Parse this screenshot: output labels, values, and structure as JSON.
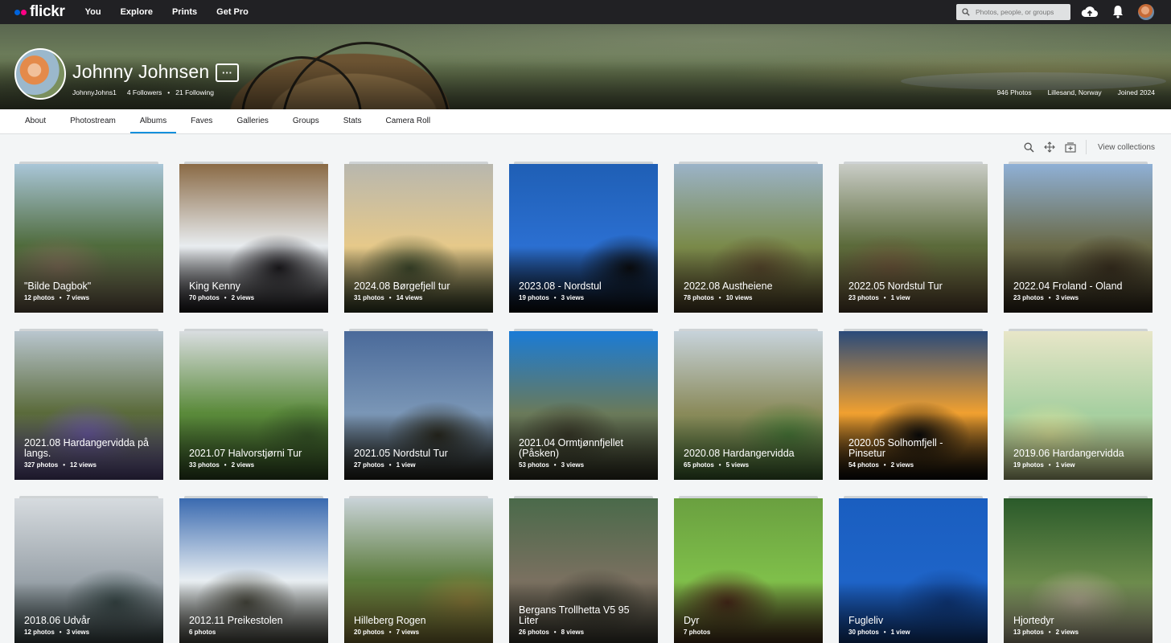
{
  "nav": {
    "logo": "flickr",
    "links": [
      "You",
      "Explore",
      "Prints",
      "Get Pro"
    ],
    "search_placeholder": "Photos, people, or groups",
    "icons": [
      "upload-icon",
      "bell-icon"
    ]
  },
  "profile": {
    "name": "Johnny Johnsen",
    "more_label": "···",
    "username": "JohnnyJohns1",
    "followers": "4 Followers",
    "separator": "•",
    "following": "21 Following",
    "photos": "946 Photos",
    "location": "Lillesand, Norway",
    "joined": "Joined 2024"
  },
  "tabs": [
    "About",
    "Photostream",
    "Albums",
    "Faves",
    "Galleries",
    "Groups",
    "Stats",
    "Camera Roll"
  ],
  "active_tab": "Albums",
  "toolbar": {
    "view_collections": "View collections"
  },
  "albums": [
    {
      "title": "\"Bilde Dagbok\"",
      "photos": "12 photos",
      "views": "7 views",
      "colors": [
        "#a9c6d8",
        "#4f6b3c",
        "#7a6a55"
      ]
    },
    {
      "title": "King Kenny",
      "photos": "70 photos",
      "views": "2 views",
      "colors": [
        "#8a6a45",
        "#e8ecef",
        "#1d1b1f"
      ]
    },
    {
      "title": "2024.08 Børgefjell tur",
      "photos": "31 photos",
      "views": "14 views",
      "colors": [
        "#b8b7ae",
        "#e6c98a",
        "#3f4a2d"
      ]
    },
    {
      "title": "2023.08 - Nordstul",
      "photos": "19 photos",
      "views": "3 views",
      "colors": [
        "#1f5fb5",
        "#2b6fd1",
        "#0b0d10"
      ]
    },
    {
      "title": "2022.08 Austheiene",
      "photos": "78 photos",
      "views": "10 views",
      "colors": [
        "#9bb3c8",
        "#7a8a4a",
        "#5a4a2e"
      ]
    },
    {
      "title": "2022.05 Nordstul Tur",
      "photos": "23 photos",
      "views": "1 view",
      "colors": [
        "#c9ccc6",
        "#5b6a3a",
        "#6a553a"
      ]
    },
    {
      "title": "2022.04 Froland - Oland",
      "photos": "23 photos",
      "views": "3 views",
      "colors": [
        "#8fb0d6",
        "#6a6a48",
        "#3a3020"
      ]
    },
    {
      "title": "2021.08 Hardangervidda på langs.",
      "photos": "327 photos",
      "views": "12 views",
      "colors": [
        "#b9c6cf",
        "#5a6a3a",
        "#6a5aa0"
      ]
    },
    {
      "title": "2021.07 Halvorstjørni Tur",
      "photos": "33 photos",
      "views": "2 views",
      "colors": [
        "#d9dde0",
        "#5a8a3a",
        "#3a5a2a"
      ]
    },
    {
      "title": "2021.05 Nordstul Tur",
      "photos": "27 photos",
      "views": "1 view",
      "colors": [
        "#4a6a9a",
        "#7a96b6",
        "#2a2a20"
      ]
    },
    {
      "title": "2021.04 Ormtjønnfjellet (Påsken)",
      "photos": "53 photos",
      "views": "3 views",
      "colors": [
        "#1a7bd6",
        "#6a7a5a",
        "#3a3a2a"
      ]
    },
    {
      "title": "2020.08 Hardangervidda",
      "photos": "65 photos",
      "views": "5 views",
      "colors": [
        "#c7d3db",
        "#8a8a5a",
        "#4a7a3a"
      ]
    },
    {
      "title": "2020.05 Solhomfjell - Pinsetur",
      "photos": "54 photos",
      "views": "2 views",
      "colors": [
        "#2a4a7a",
        "#f0a030",
        "#0a0a0a"
      ]
    },
    {
      "title": "2019.06 Hardangervidda",
      "photos": "19 photos",
      "views": "1 view",
      "colors": [
        "#e8e6c8",
        "#a6cfa0",
        "#d9e29a"
      ]
    },
    {
      "title": "2018.06 Udvår",
      "photos": "12 photos",
      "views": "3 views",
      "colors": [
        "#d6dbdf",
        "#9aa3aa",
        "#3a4a4a"
      ]
    },
    {
      "title": "2012.11 Preikestolen",
      "photos": "6 photos",
      "views": "",
      "colors": [
        "#3a6ab0",
        "#e8eef2",
        "#4a4a40"
      ]
    },
    {
      "title": "Hilleberg Rogen",
      "photos": "20 photos",
      "views": "7 views",
      "colors": [
        "#c9d3d8",
        "#5a7a3a",
        "#8a7a3a"
      ]
    },
    {
      "title": "Bergans Trollhetta V5 95 Liter",
      "photos": "26 photos",
      "views": "8 views",
      "colors": [
        "#4a6a4a",
        "#7a7060",
        "#3a3a30"
      ]
    },
    {
      "title": "Dyr",
      "photos": "7 photos",
      "views": "",
      "colors": [
        "#6aa040",
        "#7fbf4a",
        "#4a2a1a"
      ]
    },
    {
      "title": "Fugleliv",
      "photos": "30 photos",
      "views": "1 view",
      "colors": [
        "#1a5ec0",
        "#1e64c8",
        "#0f3a80"
      ]
    },
    {
      "title": "Hjortedyr",
      "photos": "13 photos",
      "views": "2 views",
      "colors": [
        "#2a5a2a",
        "#6a8a4a",
        "#b0a890"
      ]
    }
  ]
}
